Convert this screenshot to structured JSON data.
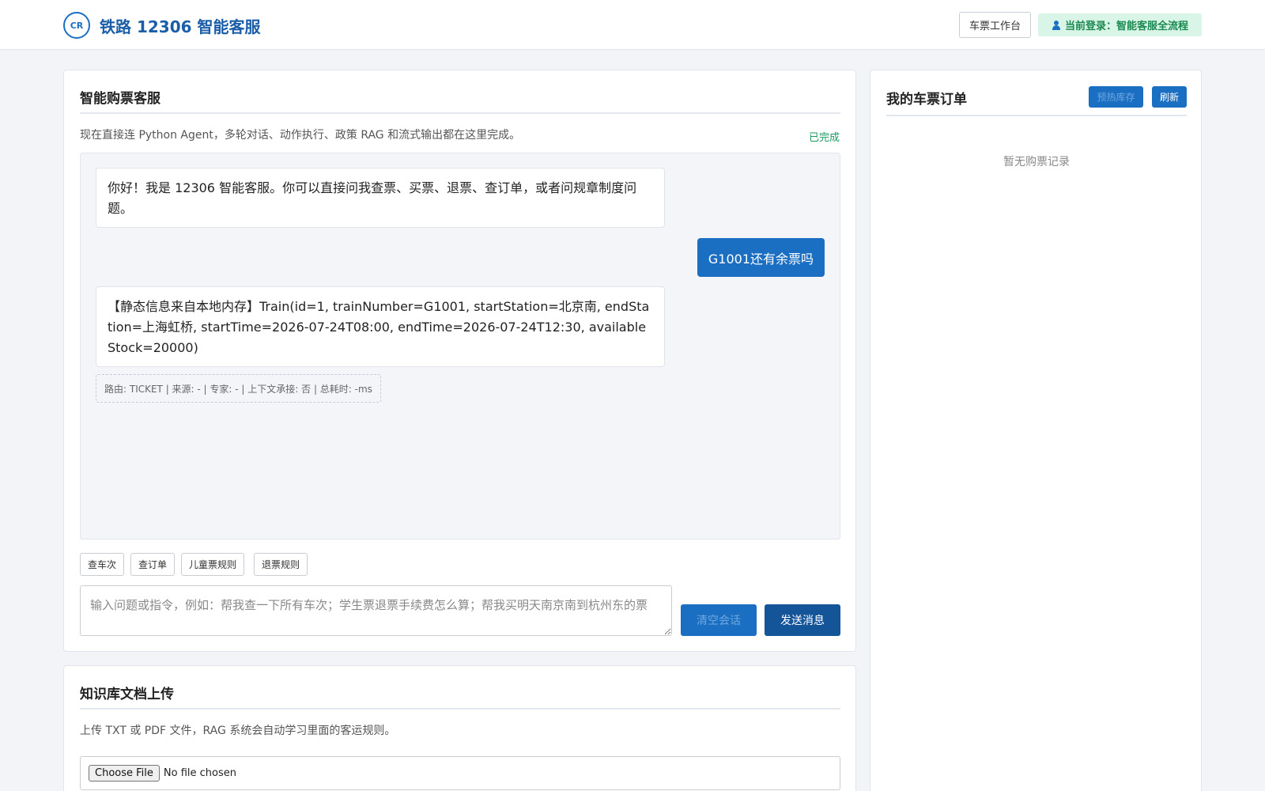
{
  "header": {
    "logo_text": "CR",
    "title": "铁路 12306 智能客服",
    "workbench_label": "车票工作台",
    "login_label": "当前登录：智能客服全流程"
  },
  "chat": {
    "title": "智能购票客服",
    "description": "现在直接连 Python Agent，多轮对话、动作执行、政策 RAG 和流式输出都在这里完成。",
    "status": "已完成",
    "messages": [
      {
        "role": "assistant",
        "text": "你好！我是 12306 智能客服。你可以直接问我查票、买票、退票、查订单，或者问规章制度问题。"
      },
      {
        "role": "user",
        "text": "G1001还有余票吗"
      },
      {
        "role": "assistant",
        "text": "【静态信息来自本地内存】Train(id=1, trainNumber=G1001, startStation=北京南, endStation=上海虹桥, startTime=2026-07-24T08:00, endTime=2026-07-24T12:30, availableStock=20000)"
      }
    ],
    "meta": "路由: TICKET | 来源: - | 专家: - | 上下文承接: 否 | 总耗时: -ms",
    "quick_actions": [
      "查车次",
      "查订单",
      "儿童票规则",
      "退票规则"
    ],
    "input_placeholder": "输入问题或指令，例如：帮我查一下所有车次；学生票退票手续费怎么算；帮我买明天南京南到杭州东的票",
    "clear_label": "清空会话",
    "send_label": "发送消息"
  },
  "kb": {
    "title": "知识库文档上传",
    "description": "上传 TXT 或 PDF 文件，RAG 系统会自动学习里面的客运规则。",
    "file_button": "Choose File",
    "file_status": "No file chosen"
  },
  "orders": {
    "title": "我的车票订单",
    "warm_label": "预热库存",
    "refresh_label": "刷新",
    "empty_text": "暂无购票记录"
  },
  "colors": {
    "primary": "#1b6fc2",
    "primary_dark": "#14559a",
    "success": "#1a9a60",
    "login_bg": "#d9f5e8"
  }
}
